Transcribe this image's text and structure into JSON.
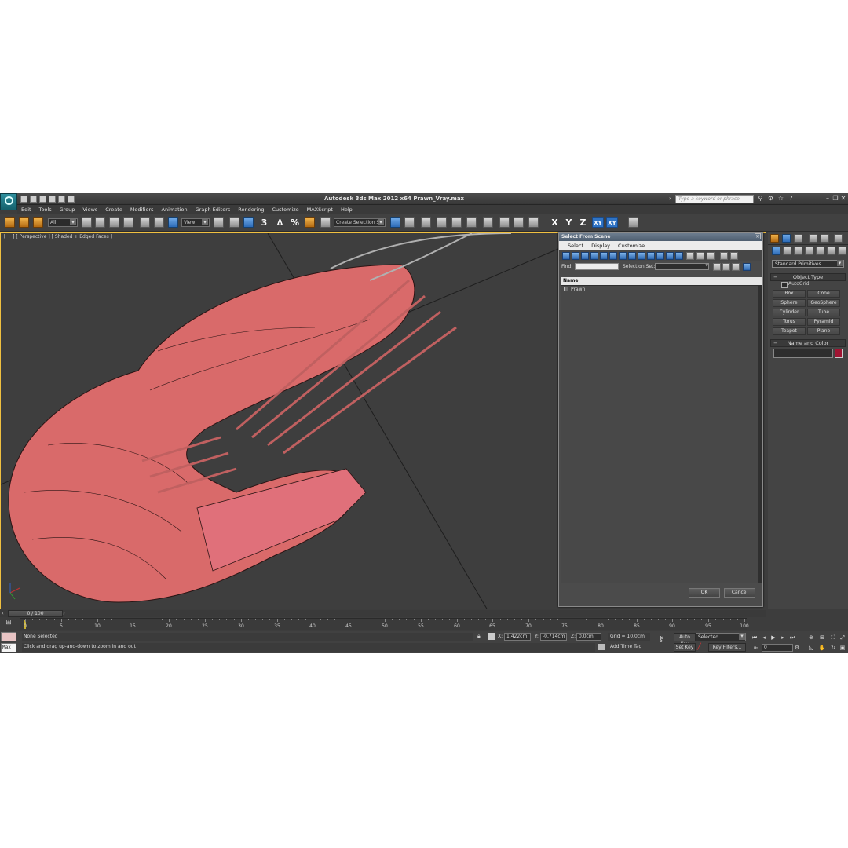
{
  "app": {
    "title": "Autodesk 3ds Max  2012 x64     Prawn_Vray.max",
    "search_placeholder": "Type a keyword or phrase"
  },
  "menu": [
    "Edit",
    "Tools",
    "Group",
    "Views",
    "Create",
    "Modifiers",
    "Animation",
    "Graph Editors",
    "Rendering",
    "Customize",
    "MAXScript",
    "Help"
  ],
  "toolbar": {
    "selection_filter": "All",
    "reference_coord": "View",
    "snap_3": "3",
    "snap_angle_label": "∆",
    "snap_percent": "%",
    "named_selection": "Create Selection Se",
    "axis_x": "X",
    "axis_y": "Y",
    "axis_z": "Z",
    "axis_xy": "XY",
    "axis_xy2": "XY"
  },
  "viewport": {
    "label": "[ + ] [ Perspective ] [ Shaded + Edged Faces ]",
    "object_color": "#d96a6a"
  },
  "select_dialog": {
    "title": "Select From Scene",
    "menu": [
      "Select",
      "Display",
      "Customize"
    ],
    "find_label": "Find:",
    "selection_set_label": "Selection Set:",
    "column_name": "Name",
    "items": [
      "Prawn"
    ],
    "ok_label": "OK",
    "cancel_label": "Cancel"
  },
  "command_panel": {
    "category": "Standard Primitives",
    "object_type_title": "Object Type",
    "autogrid_label": "AutoGrid",
    "primitives": [
      "Box",
      "Cone",
      "Sphere",
      "GeoSphere",
      "Cylinder",
      "Tube",
      "Torus",
      "Pyramid",
      "Teapot",
      "Plane"
    ],
    "name_color_title": "Name and Color",
    "color": "#a01432"
  },
  "timeline": {
    "slider_label": "0 / 100",
    "ticks": [
      "0",
      "5",
      "10",
      "15",
      "20",
      "25",
      "30",
      "35",
      "40",
      "45",
      "50",
      "55",
      "60",
      "65",
      "70",
      "75",
      "80",
      "85",
      "90",
      "95",
      "100"
    ]
  },
  "status": {
    "selection": "None Selected",
    "prompt": "Click and drag up-and-down to zoom in and out",
    "maxscript_label": "Max",
    "x_label": "X:",
    "x_value": "1,422cm",
    "y_label": "Y:",
    "y_value": "-0,714cm",
    "z_label": "Z:",
    "z_value": "0,0cm",
    "grid": "Grid = 10,0cm",
    "add_time_tag": "Add Time Tag",
    "auto_key": "Auto Key",
    "set_key": "Set Key",
    "selected": "Selected",
    "key_filters": "Key Filters...",
    "frame": "0"
  }
}
